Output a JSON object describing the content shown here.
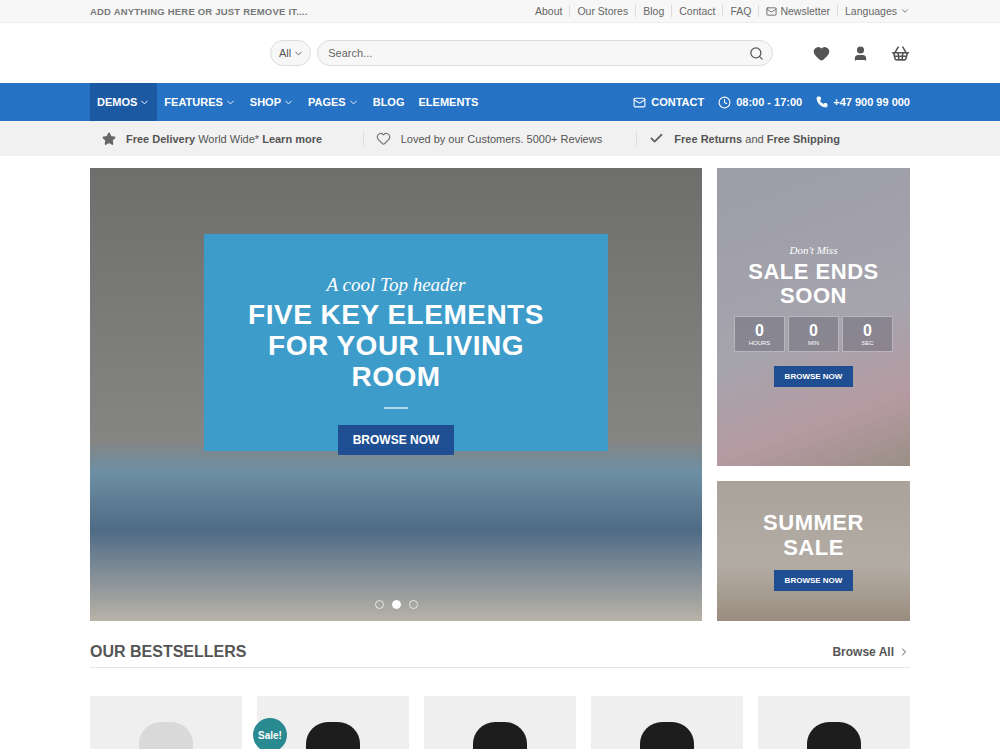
{
  "top_bar": {
    "message": "ADD ANYTHING HERE OR JUST REMOVE IT....",
    "links": [
      {
        "label": "About",
        "kind": "link"
      },
      {
        "label": "Our Stores",
        "kind": "link"
      },
      {
        "label": "Blog",
        "kind": "link"
      },
      {
        "label": "Contact",
        "kind": "link"
      },
      {
        "label": "FAQ",
        "kind": "link"
      },
      {
        "label": "Newsletter",
        "kind": "newsletter"
      },
      {
        "label": "Languages",
        "kind": "dropdown"
      }
    ]
  },
  "search": {
    "category": "All",
    "placeholder": "Search..."
  },
  "nav": {
    "items": [
      {
        "label": "DEMOS",
        "dropdown": true,
        "selected": true
      },
      {
        "label": "FEATURES",
        "dropdown": true,
        "selected": false
      },
      {
        "label": "SHOP",
        "dropdown": true,
        "selected": false
      },
      {
        "label": "PAGES",
        "dropdown": true,
        "selected": false
      },
      {
        "label": "BLOG",
        "dropdown": false,
        "selected": false
      },
      {
        "label": "ELEMENTS",
        "dropdown": false,
        "selected": false
      }
    ],
    "contact": "CONTACT",
    "hours": "08:00 - 17:00",
    "phone": "+47 900 99 000"
  },
  "benefits": [
    {
      "kind": "delivery",
      "segments": [
        {
          "text": "Free Delivery",
          "bold": true
        },
        {
          "text": " World Wide* ",
          "bold": false
        },
        {
          "text": "Learn more",
          "bold": true
        }
      ]
    },
    {
      "kind": "reviews",
      "segments": [
        {
          "text": "Loved by our Customers. 5000+ Reviews",
          "bold": false
        }
      ]
    },
    {
      "kind": "returns",
      "segments": [
        {
          "text": "Free Returns",
          "bold": true
        },
        {
          "text": " and ",
          "bold": false
        },
        {
          "text": "Free Shipping",
          "bold": true
        }
      ]
    }
  ],
  "slider": {
    "kicker": "A cool Top header",
    "title_lines": [
      "FIVE KEY ELEMENTS",
      "FOR YOUR LIVING",
      "ROOM"
    ],
    "button": "BROWSE NOW",
    "dots": [
      {
        "selected": false
      },
      {
        "selected": true
      },
      {
        "selected": false
      }
    ]
  },
  "promos": [
    {
      "kind": "countdown",
      "kicker": "Don't Miss",
      "title_lines": [
        "SALE ENDS",
        "SOON"
      ],
      "countdown": [
        {
          "value": "0",
          "unit": "HOURS"
        },
        {
          "value": "0",
          "unit": "MIN"
        },
        {
          "value": "0",
          "unit": "SEC"
        }
      ],
      "button": "BROWSE NOW"
    },
    {
      "kind": "plain",
      "kicker": "",
      "title_lines": [
        "SUMMER",
        "SALE"
      ],
      "countdown": [],
      "button": "BROWSE NOW"
    }
  ],
  "bestsellers": {
    "title": "OUR BESTSELLERS",
    "link": "Browse All",
    "sale_badge": "Sale!",
    "products": [
      {
        "sale": false
      },
      {
        "sale": true
      },
      {
        "sale": false
      },
      {
        "sale": false
      },
      {
        "sale": false
      }
    ]
  }
}
